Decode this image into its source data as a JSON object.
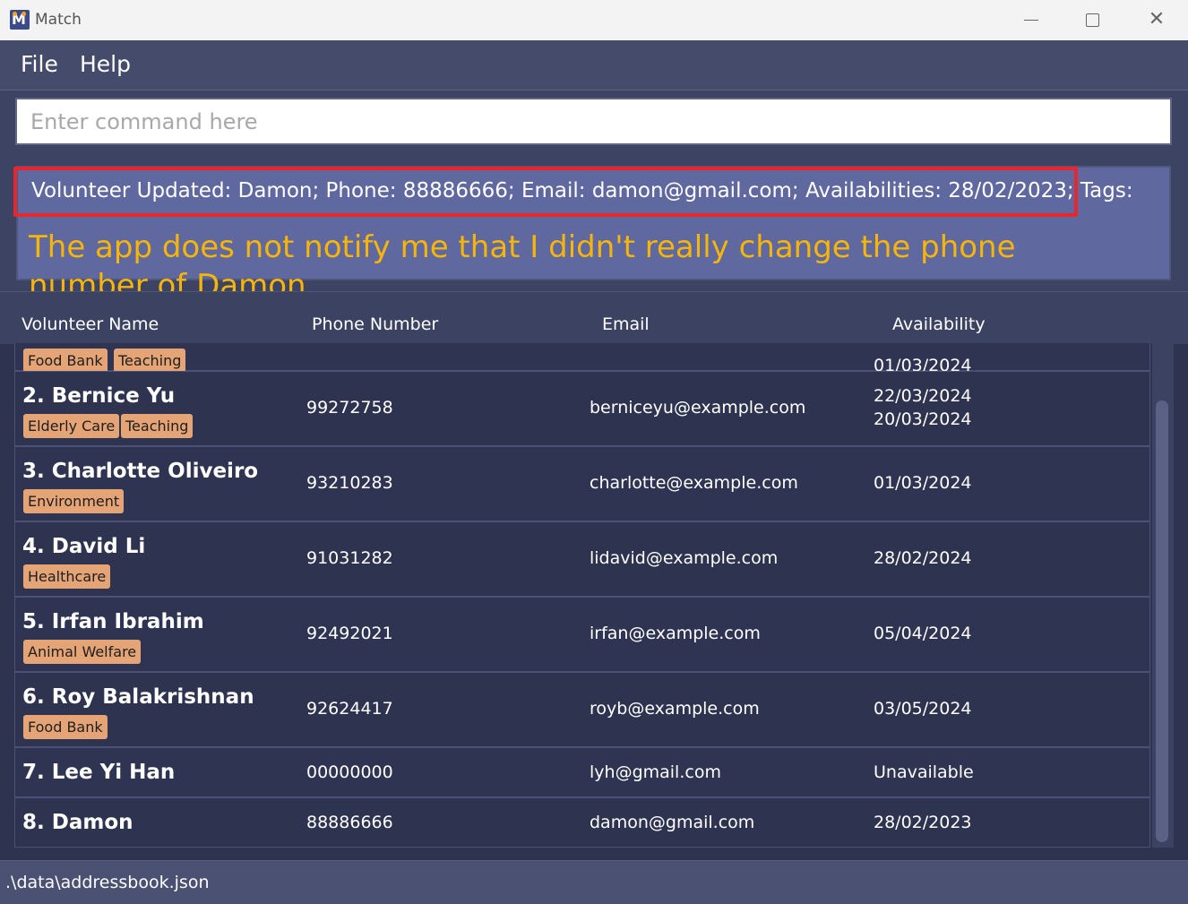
{
  "window": {
    "title": "Match",
    "close_glyph": "✕"
  },
  "menu": {
    "file": "File",
    "help": "Help"
  },
  "command": {
    "placeholder": "Enter command here",
    "value": ""
  },
  "result": {
    "message": "Volunteer Updated: Damon; Phone: 88886666; Email: damon@gmail.com; Availabilities: 28/02/2023; Tags:"
  },
  "annotation": {
    "text": "The app does not notify me that I didn't really change the phone number of Damon",
    "color": "#f5b50a",
    "highlight_color": "#e8262c"
  },
  "table": {
    "headers": {
      "name": "Volunteer Name",
      "phone": "Phone Number",
      "email": "Email",
      "availability": "Availability"
    },
    "rows": [
      {
        "name": "",
        "phone": "",
        "email": "",
        "availability": [
          "01/03/2024"
        ],
        "tags": [
          "Food Bank",
          "Teaching"
        ]
      },
      {
        "name": "2. Bernice Yu",
        "phone": "99272758",
        "email": "berniceyu@example.com",
        "availability": [
          "22/03/2024",
          "20/03/2024"
        ],
        "tags": [
          "Elderly Care",
          "Teaching"
        ]
      },
      {
        "name": "3. Charlotte Oliveiro",
        "phone": "93210283",
        "email": "charlotte@example.com",
        "availability": [
          "01/03/2024"
        ],
        "tags": [
          "Environment"
        ]
      },
      {
        "name": "4. David Li",
        "phone": "91031282",
        "email": "lidavid@example.com",
        "availability": [
          "28/02/2024"
        ],
        "tags": [
          "Healthcare"
        ]
      },
      {
        "name": "5. Irfan Ibrahim",
        "phone": "92492021",
        "email": "irfan@example.com",
        "availability": [
          "05/04/2024"
        ],
        "tags": [
          "Animal Welfare"
        ]
      },
      {
        "name": "6. Roy Balakrishnan",
        "phone": "92624417",
        "email": "royb@example.com",
        "availability": [
          "03/05/2024"
        ],
        "tags": [
          "Food Bank"
        ]
      },
      {
        "name": "7. Lee Yi Han",
        "phone": "00000000",
        "email": "lyh@gmail.com",
        "availability": [
          "Unavailable"
        ],
        "tags": []
      },
      {
        "name": "8. Damon",
        "phone": "88886666",
        "email": "damon@gmail.com",
        "availability": [
          "28/02/2023"
        ],
        "tags": []
      }
    ],
    "tag_color": "#e5a476"
  },
  "status": {
    "path": ".\\data\\addressbook.json"
  }
}
